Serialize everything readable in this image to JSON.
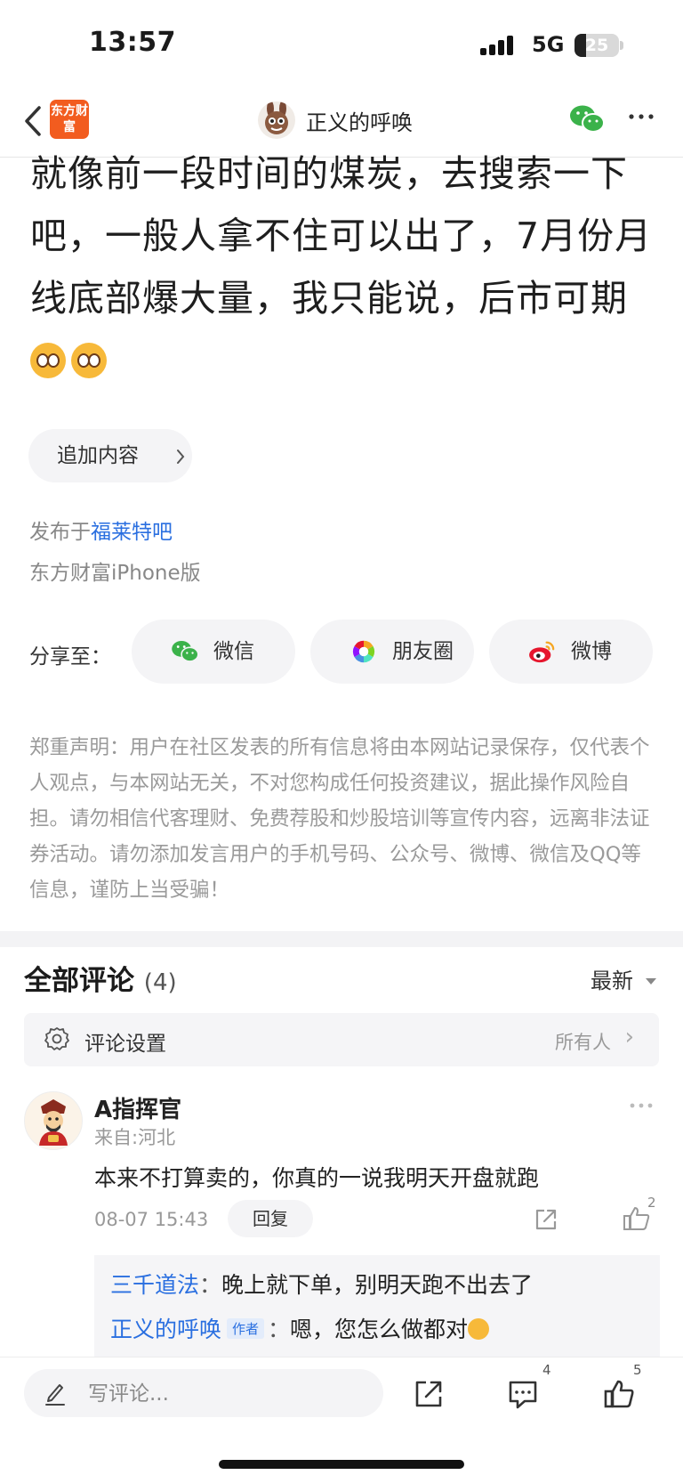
{
  "status_bar": {
    "time": "13:57",
    "network": "5G",
    "battery": "25",
    "battery_level": 0.25
  },
  "nav": {
    "logo_text": "东方财富",
    "back_icon": "chevron-left-icon",
    "title": "正义的呼唤",
    "share_icon": "wechat-icon",
    "more_icon": "more-dots-icon"
  },
  "post": {
    "text": "就像前一段时间的煤炭，去搜索一下吧，一般人拿不住可以出了，7月份月线底部爆大量，我只能说，后市可期",
    "emojis": [
      "flushed-face-emoji",
      "flushed-face-emoji"
    ]
  },
  "append_button": "追加内容",
  "published": {
    "prefix": "发布于",
    "forum": "福莱特吧",
    "source": "东方财富iPhone版"
  },
  "share": {
    "label": "分享至：",
    "targets": [
      {
        "label": "微信",
        "icon": "wechat-icon",
        "color": "#3bb24a"
      },
      {
        "label": "朋友圈",
        "icon": "moments-icon",
        "color": "#f5a623"
      },
      {
        "label": "微博",
        "icon": "weibo-icon",
        "color": "#e6162d"
      }
    ]
  },
  "disclaimer": "郑重声明：用户在社区发表的所有信息将由本网站记录保存，仅代表个人观点，与本网站无关，不对您构成任何投资建议，据此操作风险自担。请勿相信代客理财、免费荐股和炒股培训等宣传内容，远离非法证券活动。请勿添加发言用户的手机号码、公众号、微博、微信及QQ等信息，谨防上当受骗！",
  "comments": {
    "title": "全部评论",
    "count": "(4)",
    "sort": "最新",
    "settings": {
      "label": "评论设置",
      "value": "所有人"
    },
    "items": [
      {
        "author": "A指挥官",
        "location": "来自:河北",
        "text": "本来不打算卖的，你真的一说我明天开盘就跑",
        "time": "08-07 15:43",
        "reply_label": "回复",
        "likes": "2",
        "replies": [
          {
            "author": "三千道法",
            "text": "晚上就下单，别明天跑不出去了"
          },
          {
            "author": "正义的呼唤",
            "badge": "作者",
            "text": "嗯，您怎么做都对"
          }
        ]
      }
    ]
  },
  "bottom_bar": {
    "comment_placeholder": "写评论...",
    "comment_count": "4",
    "like_count": "5"
  },
  "colors": {
    "brand": "#f25c1f",
    "link": "#2a6fe0",
    "wechat": "#3bb24a"
  }
}
